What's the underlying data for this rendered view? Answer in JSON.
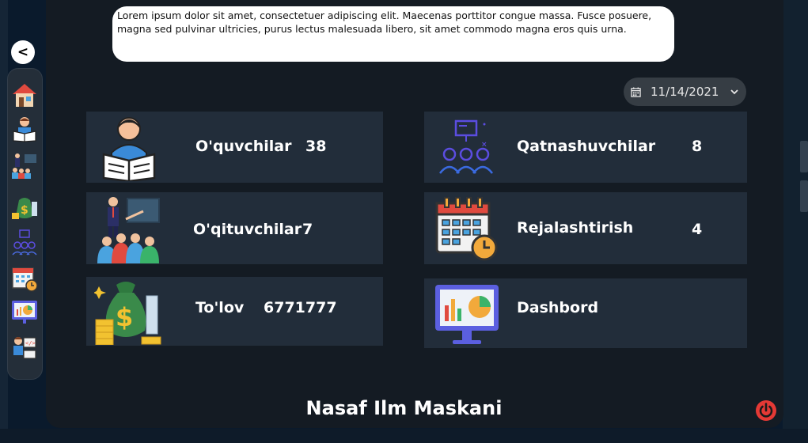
{
  "intro_text": "Lorem ipsum dolor sit amet, consectetuer adipiscing elit. Maecenas porttitor congue massa. Fusce posuere, magna sed pulvinar ultricies, purus lectus malesuada libero, sit amet commodo magna eros quis urna.",
  "back_label": "<",
  "date_picker": {
    "value": "11/14/2021"
  },
  "cards": {
    "students": {
      "label": "O'quvchilar",
      "value": "38"
    },
    "participants": {
      "label": "Qatnashuvchilar",
      "value": "8"
    },
    "teachers": {
      "label": "O'qituvchilar",
      "value": "7"
    },
    "schedule": {
      "label": "Rejalashtirish",
      "value": "4"
    },
    "payment": {
      "label": "To'lov",
      "value": "6771777"
    },
    "dashboard": {
      "label": "Dashbord"
    }
  },
  "footer_title": "Nasaf Ilm Maskani",
  "colors": {
    "card_bg": "#222d3a",
    "window_bg": "#141b23",
    "power_red": "#e53935"
  },
  "sidebar_icons": [
    "home-icon",
    "reader-icon",
    "teacher-icon",
    "money-icon",
    "participants-icon",
    "calendar-icon",
    "dashboard-icon",
    "developer-icon"
  ]
}
